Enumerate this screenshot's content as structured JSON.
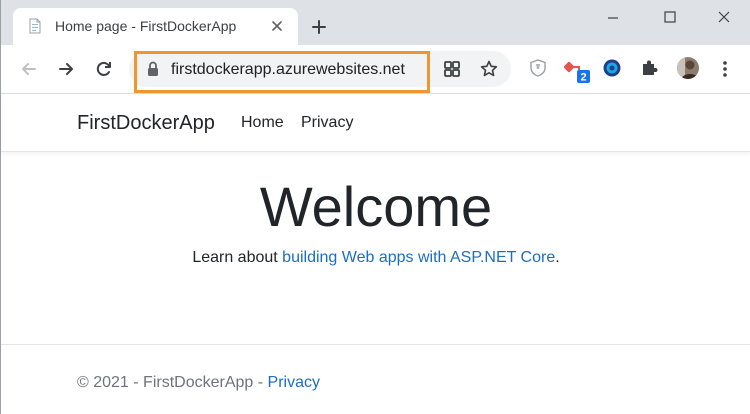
{
  "tab": {
    "title": "Home page - FirstDockerApp"
  },
  "address_bar": {
    "url": "firstdockerapp.azurewebsites.net"
  },
  "extensions": {
    "badge_count": "2"
  },
  "site": {
    "brand": "FirstDockerApp",
    "nav": {
      "home": "Home",
      "privacy": "Privacy"
    },
    "heading": "Welcome",
    "learn_prefix": "Learn about ",
    "learn_link": "building Web apps with ASP.NET Core",
    "learn_suffix": ".",
    "footer_text": "© 2021 - FirstDockerApp - ",
    "footer_link": "Privacy"
  },
  "colors": {
    "highlight": "#f0962e",
    "link": "#1b6ec2"
  }
}
